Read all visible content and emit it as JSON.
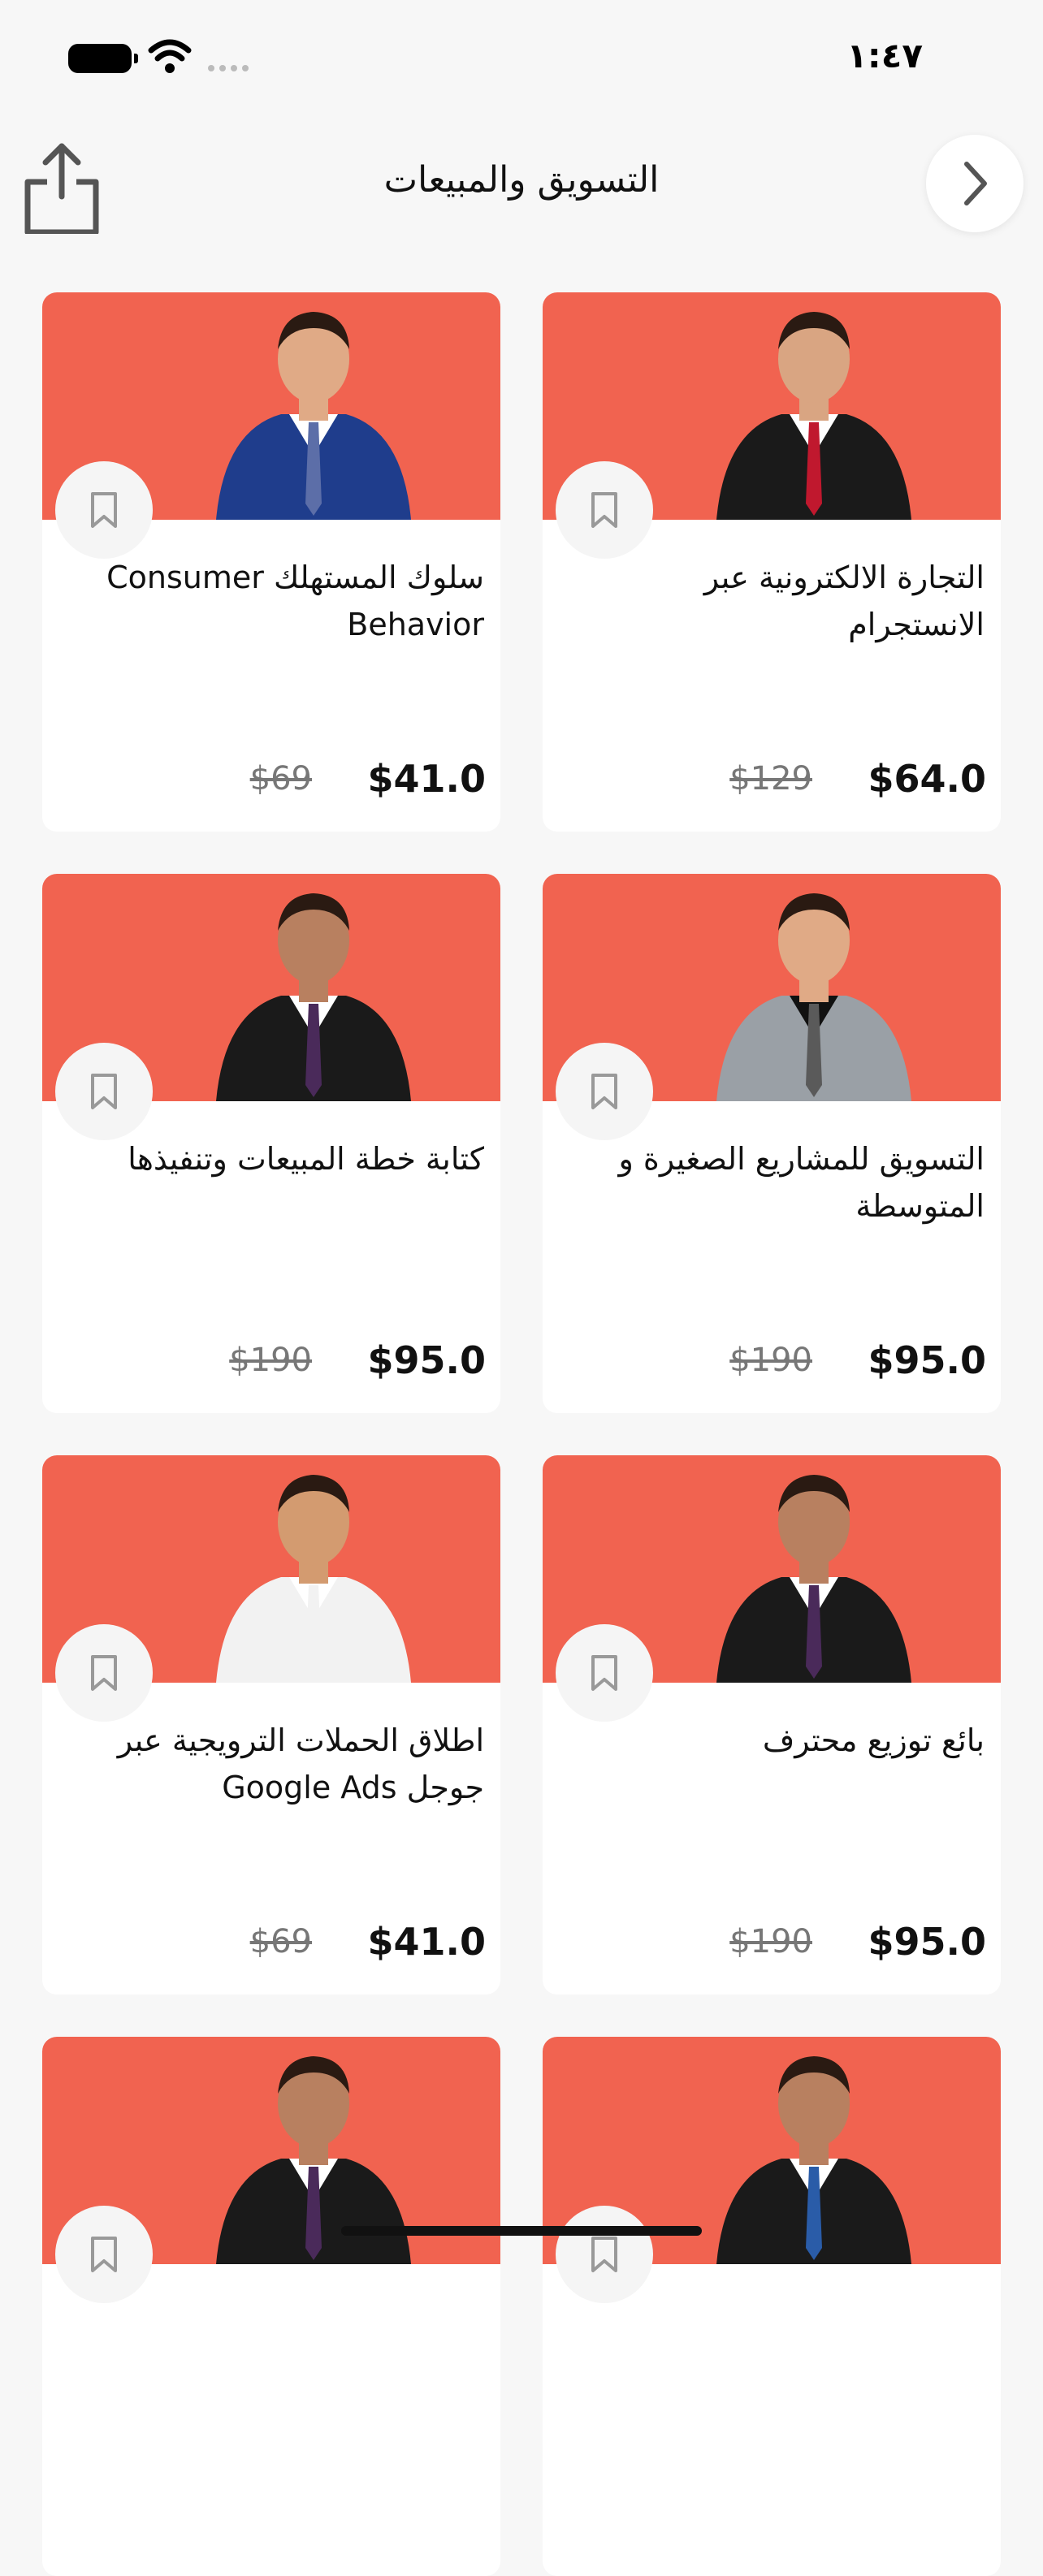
{
  "status": {
    "time": "١:٤٧"
  },
  "nav": {
    "title": "التسويق والمبيعات"
  },
  "cards": [
    {
      "title": "التجارة الالكترونية عبر الانستجرام",
      "price": "$64.0",
      "old_price": "$129",
      "suit": "#1a1a1a",
      "tie": "#c0182e",
      "shirt": "#ffffff",
      "skin": "#d9a582"
    },
    {
      "title": "سلوك المستهلك Consumer Behavior",
      "price": "$41.0",
      "old_price": "$69",
      "suit": "#1f3d8c",
      "tie": "#5c6ea8",
      "shirt": "#ffffff",
      "skin": "#e0aa86"
    },
    {
      "title": "التسويق للمشاريع الصغيرة و المتوسطة",
      "price": "$95.0",
      "old_price": "$190",
      "suit": "#9aa0a6",
      "tie": "#5a5a5a",
      "shirt": "#111111",
      "skin": "#e0aa86"
    },
    {
      "title": "كتابة خطة المبيعات وتنفيذها",
      "price": "$95.0",
      "old_price": "$190",
      "suit": "#1a1a1a",
      "tie": "#4a2a5a",
      "shirt": "#ffffff",
      "skin": "#b88060"
    },
    {
      "title": "بائع توزيع محترف",
      "price": "$95.0",
      "old_price": "$190",
      "suit": "#1a1a1a",
      "tie": "#4a2a5a",
      "shirt": "#ffffff",
      "skin": "#b88060"
    },
    {
      "title": "اطلاق الحملات الترويجية عبر جوجل Google Ads",
      "price": "$41.0",
      "old_price": "$69",
      "suit": "#f2f2f2",
      "tie": "#f2f2f2",
      "shirt": "#ffffff",
      "skin": "#d39b70"
    },
    {
      "title": "",
      "price": "",
      "old_price": "",
      "suit": "#1a1a1a",
      "tie": "#2a5ca8",
      "shirt": "#ffffff",
      "skin": "#b88060"
    },
    {
      "title": "",
      "price": "",
      "old_price": "",
      "suit": "#1a1a1a",
      "tie": "#4a2a5a",
      "shirt": "#ffffff",
      "skin": "#b88060"
    }
  ],
  "icons": {
    "share": "share-icon",
    "forward": "chevron-right-icon",
    "bookmark": "bookmark-icon"
  },
  "colors": {
    "card_header": "#f16350",
    "background": "#f7f7f7"
  }
}
